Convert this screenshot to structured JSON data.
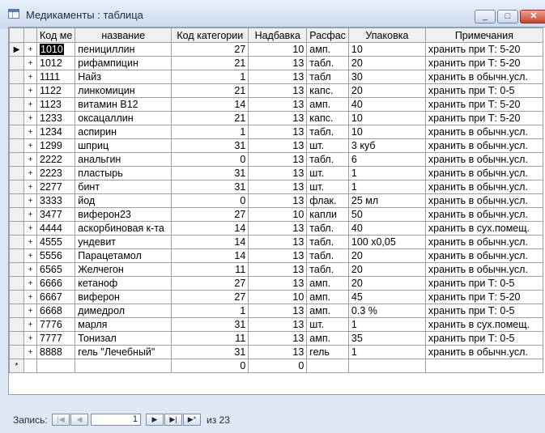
{
  "window": {
    "title": "Медикаменты : таблица"
  },
  "title_buttons": {
    "minimize": "_",
    "maximize": "□",
    "close": "✕"
  },
  "columns": [
    "Код ме",
    "название",
    "Код категории",
    "Надбавка",
    "Расфас",
    "Упаковка",
    "Примечания"
  ],
  "rows": [
    {
      "code": "1010",
      "name": "пенициллин",
      "cat": "27",
      "markup": "10",
      "form": "амп.",
      "pack": "10",
      "note": "хранить при Т: 5-20"
    },
    {
      "code": "1012",
      "name": "рифампицин",
      "cat": "21",
      "markup": "13",
      "form": "табл.",
      "pack": "20",
      "note": "хранить при Т: 5-20"
    },
    {
      "code": "1111",
      "name": "Найз",
      "cat": "1",
      "markup": "13",
      "form": "табл",
      "pack": "30",
      "note": "хранить в обычн.усл."
    },
    {
      "code": "1122",
      "name": "линкомицин",
      "cat": "21",
      "markup": "13",
      "form": "капс.",
      "pack": "20",
      "note": "хранить при Т: 0-5"
    },
    {
      "code": "1123",
      "name": "витамин В12",
      "cat": "14",
      "markup": "13",
      "form": "амп.",
      "pack": "40",
      "note": "хранить при Т: 5-20"
    },
    {
      "code": "1233",
      "name": "оксацаллин",
      "cat": "21",
      "markup": "13",
      "form": "капс.",
      "pack": "10",
      "note": "хранить при Т: 5-20"
    },
    {
      "code": "1234",
      "name": "аспирин",
      "cat": "1",
      "markup": "13",
      "form": "табл.",
      "pack": "10",
      "note": "хранить в обычн.усл."
    },
    {
      "code": "1299",
      "name": "шприц",
      "cat": "31",
      "markup": "13",
      "form": "шт.",
      "pack": "3 куб",
      "note": "хранить в обычн.усл."
    },
    {
      "code": "2222",
      "name": "анальгин",
      "cat": "0",
      "markup": "13",
      "form": "табл.",
      "pack": "6",
      "note": "хранить в обычн.усл."
    },
    {
      "code": "2223",
      "name": "пластырь",
      "cat": "31",
      "markup": "13",
      "form": "шт.",
      "pack": "1",
      "note": "хранить в обычн.усл."
    },
    {
      "code": "2277",
      "name": "бинт",
      "cat": "31",
      "markup": "13",
      "form": "шт.",
      "pack": "1",
      "note": "хранить в обычн.усл."
    },
    {
      "code": "3333",
      "name": "йод",
      "cat": "0",
      "markup": "13",
      "form": "флак.",
      "pack": "25 мл",
      "note": "хранить в обычн.усл."
    },
    {
      "code": "3477",
      "name": "виферон23",
      "cat": "27",
      "markup": "10",
      "form": "капли",
      "pack": "50",
      "note": "хранить в обычн.усл."
    },
    {
      "code": "4444",
      "name": "аскорбиновая к-та",
      "cat": "14",
      "markup": "13",
      "form": "табл.",
      "pack": "40",
      "note": "хранить  в сух.помещ."
    },
    {
      "code": "4555",
      "name": "ундевит",
      "cat": "14",
      "markup": "13",
      "form": "табл.",
      "pack": "100 х0,05",
      "note": "хранить в обычн.усл."
    },
    {
      "code": "5556",
      "name": "Парацетамол",
      "cat": "14",
      "markup": "13",
      "form": "табл.",
      "pack": "20",
      "note": "хранить в обычн.усл."
    },
    {
      "code": "6565",
      "name": "Желчегон",
      "cat": "11",
      "markup": "13",
      "form": "табл.",
      "pack": "20",
      "note": "хранить в обычн.усл."
    },
    {
      "code": "6666",
      "name": "кетаноф",
      "cat": "27",
      "markup": "13",
      "form": "амп.",
      "pack": "20",
      "note": "хранить при Т: 0-5"
    },
    {
      "code": "6667",
      "name": "виферон",
      "cat": "27",
      "markup": "10",
      "form": "амп.",
      "pack": "45",
      "note": "хранить при Т: 5-20"
    },
    {
      "code": "6668",
      "name": "димедрол",
      "cat": "1",
      "markup": "13",
      "form": "амп.",
      "pack": "0.3 %",
      "note": "хранить при Т: 0-5"
    },
    {
      "code": "7776",
      "name": "марля",
      "cat": "31",
      "markup": "13",
      "form": "шт.",
      "pack": "1",
      "note": "хранить  в сух.помещ."
    },
    {
      "code": "7777",
      "name": "Тонизал",
      "cat": "11",
      "markup": "13",
      "form": "амп.",
      "pack": "35",
      "note": "хранить при Т: 0-5"
    },
    {
      "code": "8888",
      "name": "гель \"Лечебный\"",
      "cat": "31",
      "markup": "13",
      "form": "гель",
      "pack": "1",
      "note": "хранить в обычн.усл."
    }
  ],
  "new_row": {
    "marker": "*",
    "cat": "0",
    "markup": "0"
  },
  "selector": {
    "current": "▶",
    "expand": "+"
  },
  "record_nav": {
    "label": "Запись:",
    "current": "1",
    "of_label": "из 23",
    "first": "|◀",
    "prev": "◀",
    "next": "▶",
    "last": "▶|",
    "new": "▶*"
  }
}
